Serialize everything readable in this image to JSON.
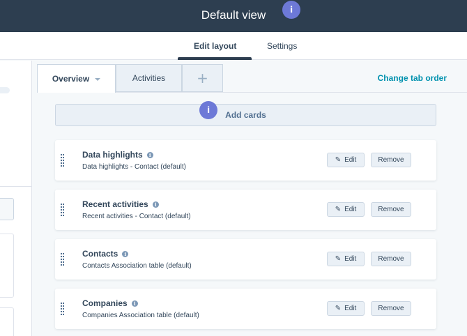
{
  "header": {
    "title": "Default view",
    "info_badge": "i"
  },
  "nav_tabs": [
    {
      "label": "Edit layout",
      "active": true
    },
    {
      "label": "Settings",
      "active": false
    }
  ],
  "content_tabs": {
    "overview": {
      "label": "Overview"
    },
    "activities": {
      "label": "Activities"
    },
    "add": {
      "label": "+"
    },
    "change_order": "Change tab order"
  },
  "add_cards": {
    "label": "Add cards",
    "info_badge": "i"
  },
  "cards": [
    {
      "title": "Data highlights",
      "subtitle": "Data highlights - Contact (default)",
      "edit": "Edit",
      "remove": "Remove"
    },
    {
      "title": "Recent activities",
      "subtitle": "Recent activities - Contact (default)",
      "edit": "Edit",
      "remove": "Remove"
    },
    {
      "title": "Contacts",
      "subtitle": "Contacts Association table (default)",
      "edit": "Edit",
      "remove": "Remove"
    },
    {
      "title": "Companies",
      "subtitle": "Companies Association table (default)",
      "edit": "Edit",
      "remove": "Remove"
    }
  ],
  "icons": {
    "info": "i",
    "edit": "✎",
    "drag": "drag-handle-icon"
  },
  "colors": {
    "header_bg": "#2d3e50",
    "accent_link": "#0091ae",
    "badge": "#6d79d7"
  }
}
